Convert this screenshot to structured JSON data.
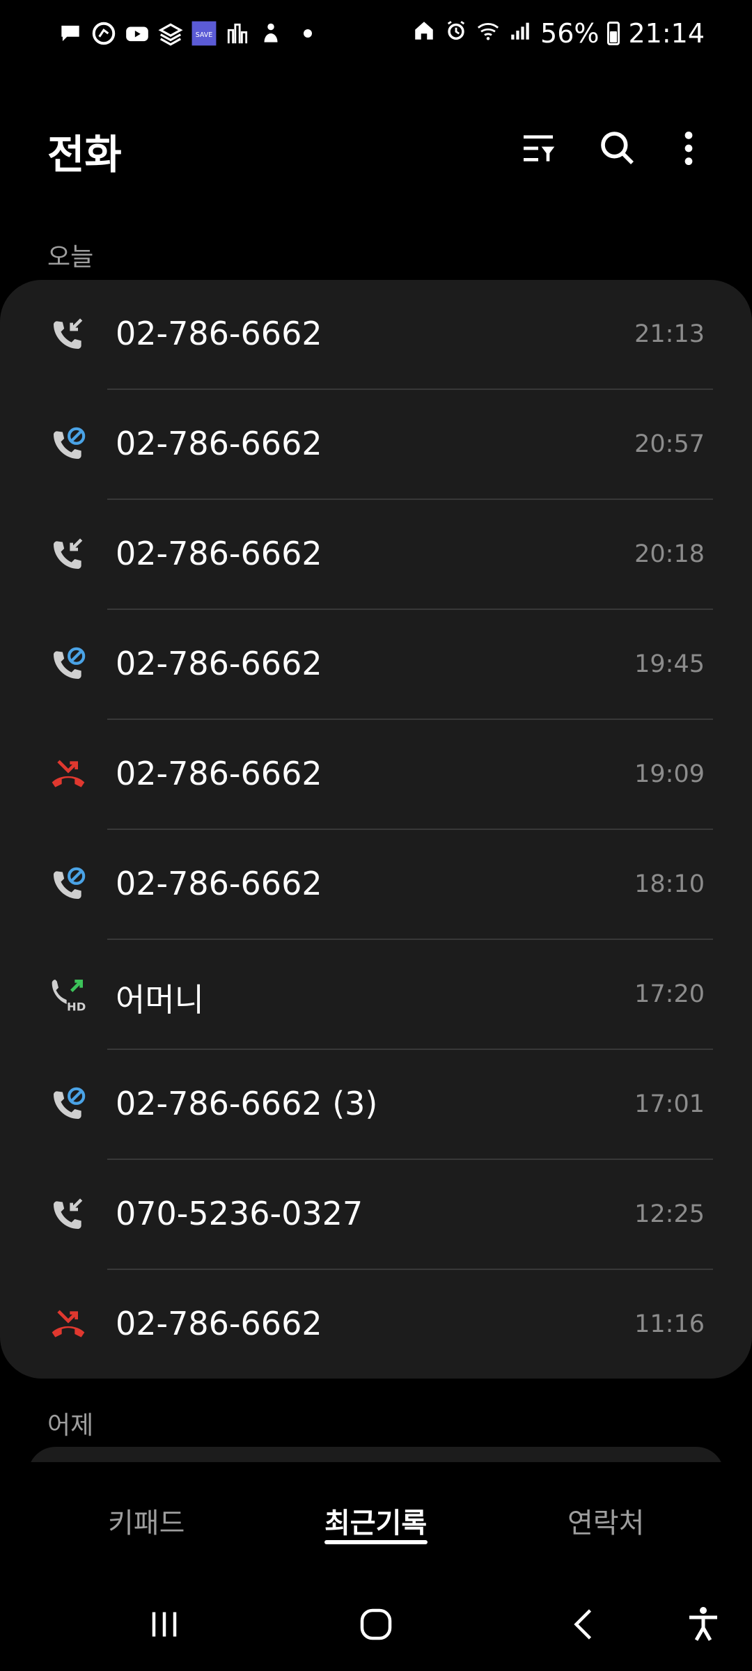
{
  "status_bar": {
    "notification_icons": [
      "chat-bubble-icon",
      "messenger-icon",
      "youtube-icon",
      "stack-icon",
      "save-app-icon",
      "buildings-icon",
      "figure-icon"
    ],
    "save_label": "SAVE",
    "battery": "56%",
    "clock": "21:14"
  },
  "header": {
    "title": "전화"
  },
  "sections": {
    "today": "오늘",
    "yesterday": "어제"
  },
  "calls": [
    {
      "type": "incoming",
      "name": "02-786-6662",
      "time": "21:13"
    },
    {
      "type": "blocked",
      "name": "02-786-6662",
      "time": "20:57"
    },
    {
      "type": "incoming",
      "name": "02-786-6662",
      "time": "20:18"
    },
    {
      "type": "blocked",
      "name": "02-786-6662",
      "time": "19:45"
    },
    {
      "type": "missed",
      "name": "02-786-6662",
      "time": "19:09"
    },
    {
      "type": "blocked",
      "name": "02-786-6662",
      "time": "18:10"
    },
    {
      "type": "outgoing-hd",
      "name": "어머니",
      "time": "17:20"
    },
    {
      "type": "blocked",
      "name": "02-786-6662 (3)",
      "time": "17:01"
    },
    {
      "type": "incoming",
      "name": "070-5236-0327",
      "time": "12:25"
    },
    {
      "type": "missed",
      "name": "02-786-6662",
      "time": "11:16"
    }
  ],
  "bottom_nav": {
    "tabs": [
      {
        "label": "키패드",
        "active": false
      },
      {
        "label": "최근기록",
        "active": true
      },
      {
        "label": "연락처",
        "active": false
      }
    ]
  },
  "colors": {
    "missed": "#e0382f",
    "blocked_accent": "#4aa3e6",
    "hd_arrow": "#3cc35a",
    "card_bg": "#1c1c1c"
  }
}
